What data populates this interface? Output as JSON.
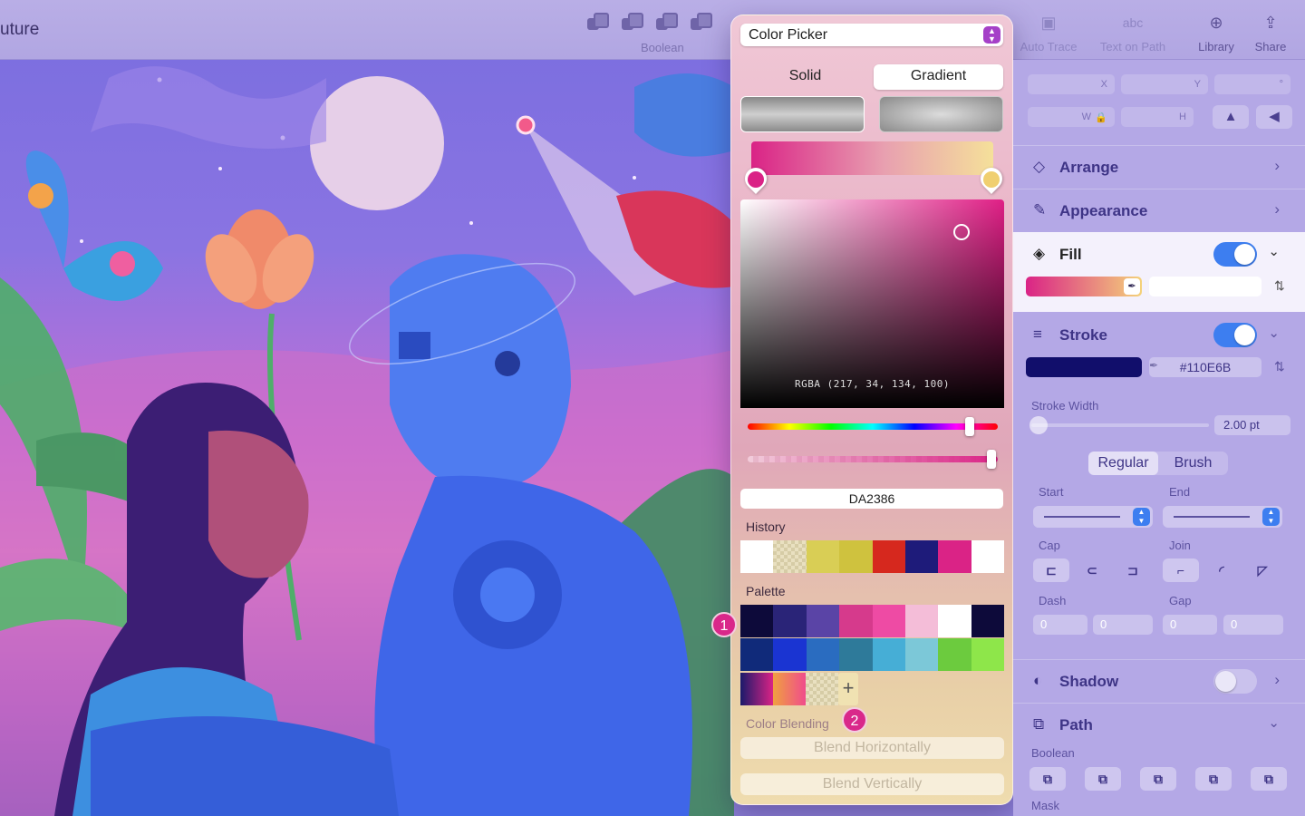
{
  "toolbar": {
    "doc_title": "uture",
    "boolean_label": "Boolean",
    "items": [
      {
        "label": "Auto Trace",
        "icon": "auto-trace-icon",
        "glyph": "▣"
      },
      {
        "label": "Text on Path",
        "icon": "text-on-path-icon",
        "glyph": "abc"
      },
      {
        "label": "Library",
        "icon": "library-icon",
        "glyph": "⊕"
      },
      {
        "label": "Share",
        "icon": "share-icon",
        "glyph": "⇪"
      }
    ]
  },
  "picker": {
    "mode_select": "Color Picker",
    "tabs": [
      "Solid",
      "Gradient"
    ],
    "active_tab": "Gradient",
    "gradient_stops": [
      "#DA2386",
      "#F4D27A"
    ],
    "rgba_readout": "RGBA (217, 34, 134, 100)",
    "hex_value": "DA2386",
    "history_label": "History",
    "history": [
      "#FFFFFF",
      "checker",
      "#D9CE55",
      "#CFC23E",
      "#D6281E",
      "#1E1B7A",
      "#DA2386",
      "#FFFFFF"
    ],
    "palette_label": "Palette",
    "palette_row1": [
      "#0D0A3A",
      "#2A2478",
      "#5A44A6",
      "#D63A8C",
      "#EE4BA4",
      "#F4BDD8",
      "#FFFFFF",
      "#0D0A3A"
    ],
    "palette_row2": [
      "#102A7A",
      "#1A34D2",
      "#2A6CC0",
      "#2E7A9A",
      "#46AED6",
      "#7CC8D8",
      "#6CCB3E",
      "#8EE64A"
    ],
    "badge_1": "1",
    "badge_2": "2",
    "add_glyph": "+",
    "blending_label": "Color Blending",
    "blend_horizontal": "Blend Horizontally",
    "blend_vertical": "Blend Vertically"
  },
  "inspector": {
    "x_label": "X",
    "y_label": "Y",
    "rot_label": "°",
    "w_label": "W",
    "h_label": "H",
    "arrange": "Arrange",
    "appearance": "Appearance",
    "fill": "Fill",
    "fill_on": true,
    "stroke": "Stroke",
    "stroke_on": true,
    "stroke_hex": "#110E6B",
    "stroke_color": "#110E6B",
    "stroke_width_label": "Stroke Width",
    "stroke_width_value": "2.00 pt",
    "brush_tabs": [
      "Regular",
      "Brush"
    ],
    "start_label": "Start",
    "end_label": "End",
    "cap_label": "Cap",
    "join_label": "Join",
    "dash_label": "Dash",
    "gap_label": "Gap",
    "dash_values": [
      "0",
      "0"
    ],
    "gap_values": [
      "0",
      "0"
    ],
    "shadow": "Shadow",
    "shadow_on": false,
    "path": "Path",
    "boolean_label": "Boolean",
    "mask_label": "Mask"
  }
}
